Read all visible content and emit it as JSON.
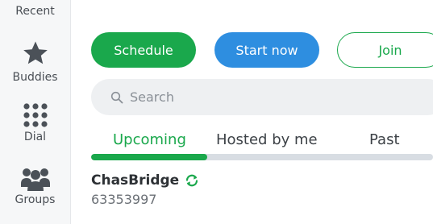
{
  "sidebar": {
    "items": [
      {
        "label": "Recent",
        "icon": "recent-icon"
      },
      {
        "label": "Buddies",
        "icon": "star-icon"
      },
      {
        "label": "Dial",
        "icon": "dialpad-icon"
      },
      {
        "label": "Groups",
        "icon": "group-icon"
      }
    ]
  },
  "actions": {
    "schedule": "Schedule",
    "start_now": "Start now",
    "join": "Join"
  },
  "search": {
    "placeholder": "Search"
  },
  "tabs": [
    {
      "label": "Upcoming",
      "active": true
    },
    {
      "label": "Hosted by me",
      "active": false
    },
    {
      "label": "Past",
      "active": false
    }
  ],
  "meetings": [
    {
      "title": "ChasBridge",
      "id": "63353997",
      "recurring_icon": "recurring-icon"
    }
  ],
  "colors": {
    "green": "#1aa84c",
    "blue": "#2e8ee0",
    "sidebar_bg": "#f6f7f8",
    "search_bg": "#eef0f2",
    "text_dark": "#2d3135",
    "text_muted": "#6b7076"
  }
}
